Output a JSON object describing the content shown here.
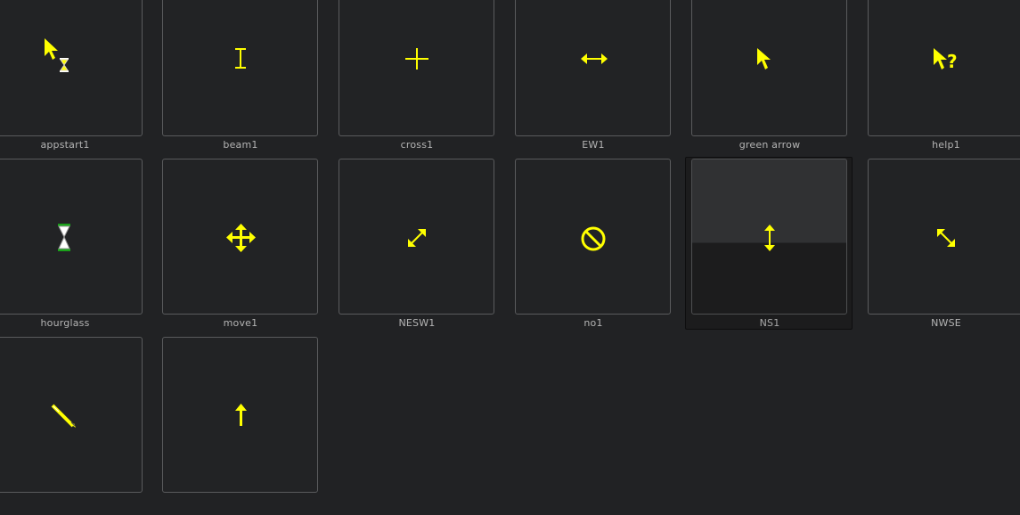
{
  "accent_color": "#ffff00",
  "items": [
    {
      "label": "appstart1",
      "icon": "appstart-cursor-icon"
    },
    {
      "label": "beam1",
      "icon": "text-beam-cursor-icon"
    },
    {
      "label": "cross1",
      "icon": "crosshair-cursor-icon"
    },
    {
      "label": "EW1",
      "icon": "resize-ew-cursor-icon"
    },
    {
      "label": "green arrow",
      "icon": "arrow-cursor-icon"
    },
    {
      "label": "help1",
      "icon": "help-cursor-icon"
    },
    {
      "label": "hourglass",
      "icon": "hourglass-cursor-icon"
    },
    {
      "label": "move1",
      "icon": "move-cursor-icon"
    },
    {
      "label": "NESW1",
      "icon": "resize-nesw-cursor-icon"
    },
    {
      "label": "no1",
      "icon": "not-allowed-cursor-icon"
    },
    {
      "label": "NS1",
      "icon": "resize-ns-cursor-icon",
      "selected": true
    },
    {
      "label": "NWSE",
      "icon": "resize-nwse-cursor-icon"
    },
    {
      "label": "",
      "icon": "pen-cursor-icon"
    },
    {
      "label": "",
      "icon": "up-arrow-cursor-icon"
    }
  ]
}
